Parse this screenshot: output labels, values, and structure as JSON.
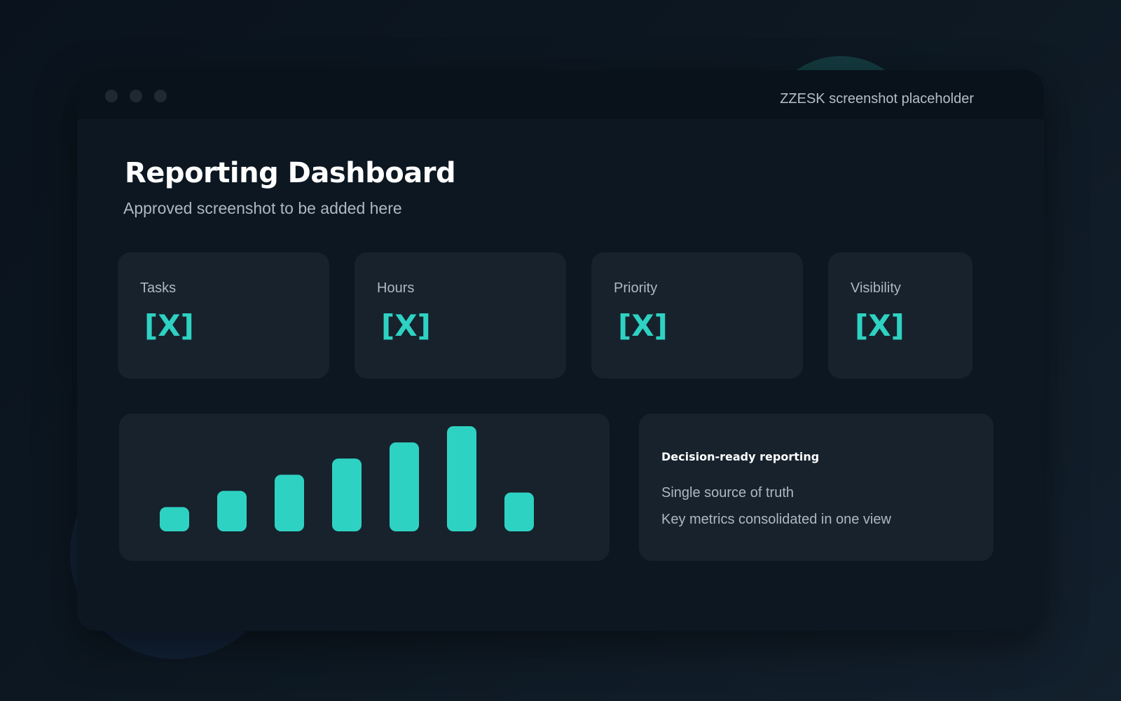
{
  "window": {
    "title": "ZZESK screenshot placeholder"
  },
  "header": {
    "title": "Reporting Dashboard",
    "subtitle": "Approved screenshot to be added here"
  },
  "metrics": [
    {
      "label": "Tasks",
      "value": "[X]"
    },
    {
      "label": "Hours",
      "value": "[X]"
    },
    {
      "label": "Priority",
      "value": "[X]"
    },
    {
      "label": "Visibility",
      "value": "[X]"
    }
  ],
  "chart_data": {
    "type": "bar",
    "categories": [
      "",
      "",
      "",
      "",
      "",
      "",
      ""
    ],
    "values": [
      1.5,
      2.5,
      3.5,
      4.5,
      5.5,
      6.5,
      2.4
    ],
    "title": "",
    "xlabel": "",
    "ylabel": "",
    "ylim": [
      0,
      6.5
    ],
    "grid": false,
    "bar_color": "#2ed2c2"
  },
  "info": {
    "heading": "Decision-ready reporting",
    "lines": [
      "Single source of truth",
      "Key metrics consolidated in one view"
    ]
  },
  "colors": {
    "accent": "#2ed2c2",
    "card": "#17222d",
    "window": "#0c1721"
  }
}
